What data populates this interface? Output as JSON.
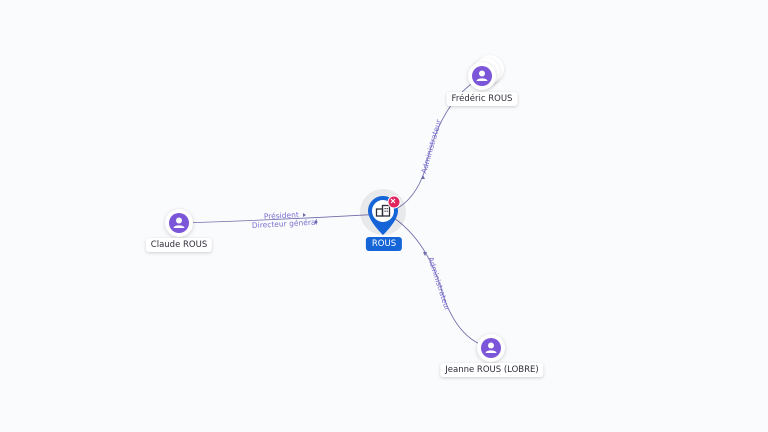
{
  "colors": {
    "accent": "#1565d8",
    "person": "#7c56d8",
    "edge": "#6e6aa8",
    "edge_label": "#7a6fd0",
    "badge": "#e0245e"
  },
  "center": {
    "label": "ROUS",
    "icon": "building-icon",
    "badge_icon": "close-icon"
  },
  "nodes": [
    {
      "id": "frederic",
      "label": "Frédéric ROUS",
      "icon": "person-icon",
      "stacked": true
    },
    {
      "id": "claude",
      "label": "Claude ROUS",
      "icon": "person-icon",
      "stacked": false
    },
    {
      "id": "jeanne",
      "label": "Jeanne ROUS (LOBRE)",
      "icon": "person-icon",
      "stacked": false
    }
  ],
  "edges": [
    {
      "from": "claude",
      "to": "center",
      "labels": [
        "Président",
        "Directeur général"
      ]
    },
    {
      "from": "frederic",
      "to": "center",
      "labels": [
        "Administrateur"
      ]
    },
    {
      "from": "jeanne",
      "to": "center",
      "labels": [
        "Administrateur"
      ]
    }
  ]
}
